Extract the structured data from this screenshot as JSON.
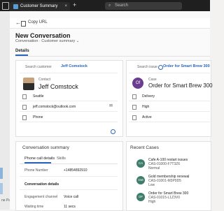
{
  "window": {
    "tab_title": "Customer Summary",
    "search_placeholder": "Search"
  },
  "toolbar": {
    "copy_url": "Copy URL"
  },
  "page": {
    "title": "New Conversation",
    "breadcrumb": "Conversation · Customer summary ⌄",
    "tab_details": "Details"
  },
  "customer": {
    "search_label": "Search customer",
    "selected": "Jeff Comstock",
    "contact_label": "Contact",
    "name": "Jeff Comstock",
    "city": "Seattle",
    "email": "jeff.comstock@outlook.com",
    "phone_label": "Phone"
  },
  "case": {
    "search_label": "Search issue",
    "selected": "Order for Smart Brew 300",
    "label": "Case",
    "avatar": "Of",
    "title": "Order for Smart Brew 300",
    "fields": [
      "Delivery",
      "High",
      "Active"
    ]
  },
  "conversation": {
    "title": "Conversation summary",
    "tab1": "Phone call details",
    "tab2": "Skills",
    "phone_label": "Phone Number",
    "phone_value": "+14854892910",
    "details_label": "Conversation details",
    "channel_label": "Engagement channel",
    "channel_value": "Voice call",
    "wait_label": "Waiting time",
    "wait_value": "11 secs"
  },
  "recent_cases": {
    "title": "Recent Cases",
    "items": [
      {
        "avatar": "CA",
        "title": "Cafe A-100 restart issues",
        "number": "CAS-01000-F7T3Z6",
        "priority": "Normal"
      },
      {
        "avatar": "GM",
        "title": "Gold membership renewal",
        "number": "CAS-01001-M3P9D5",
        "priority": "Low"
      },
      {
        "avatar": "OF",
        "title": "Order for Smart Brew 300",
        "number": "CAS-01015-L1Z3V0",
        "priority": "High"
      }
    ]
  },
  "left_rail": {
    "label": "ne Pa"
  },
  "colors": {
    "accent": "#2b65b7",
    "case_avatar": "#6a3d8f",
    "recent_avatar": "#3f7d6a",
    "topbar": "#1f1f1f"
  }
}
